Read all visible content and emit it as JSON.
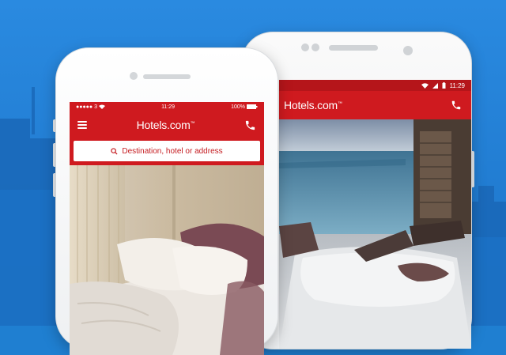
{
  "colors": {
    "background": "#1f7fd1",
    "brand_red": "#cf1a1f",
    "status_red": "#b5151a"
  },
  "iphone": {
    "status": {
      "carrier": "3",
      "time": "11:29",
      "battery": "100%"
    },
    "header": {
      "logo": "Hotels.com",
      "logo_mark": "™",
      "menu_icon": "hamburger-icon",
      "call_icon": "phone-icon"
    },
    "search": {
      "placeholder": "Destination, hotel or address",
      "icon": "search-icon"
    }
  },
  "android": {
    "status": {
      "time": "11:29",
      "icons": [
        "wifi-icon",
        "signal-icon",
        "battery-icon"
      ]
    },
    "header": {
      "logo": "Hotels.com",
      "logo_mark": "™",
      "call_icon": "phone-icon"
    }
  }
}
